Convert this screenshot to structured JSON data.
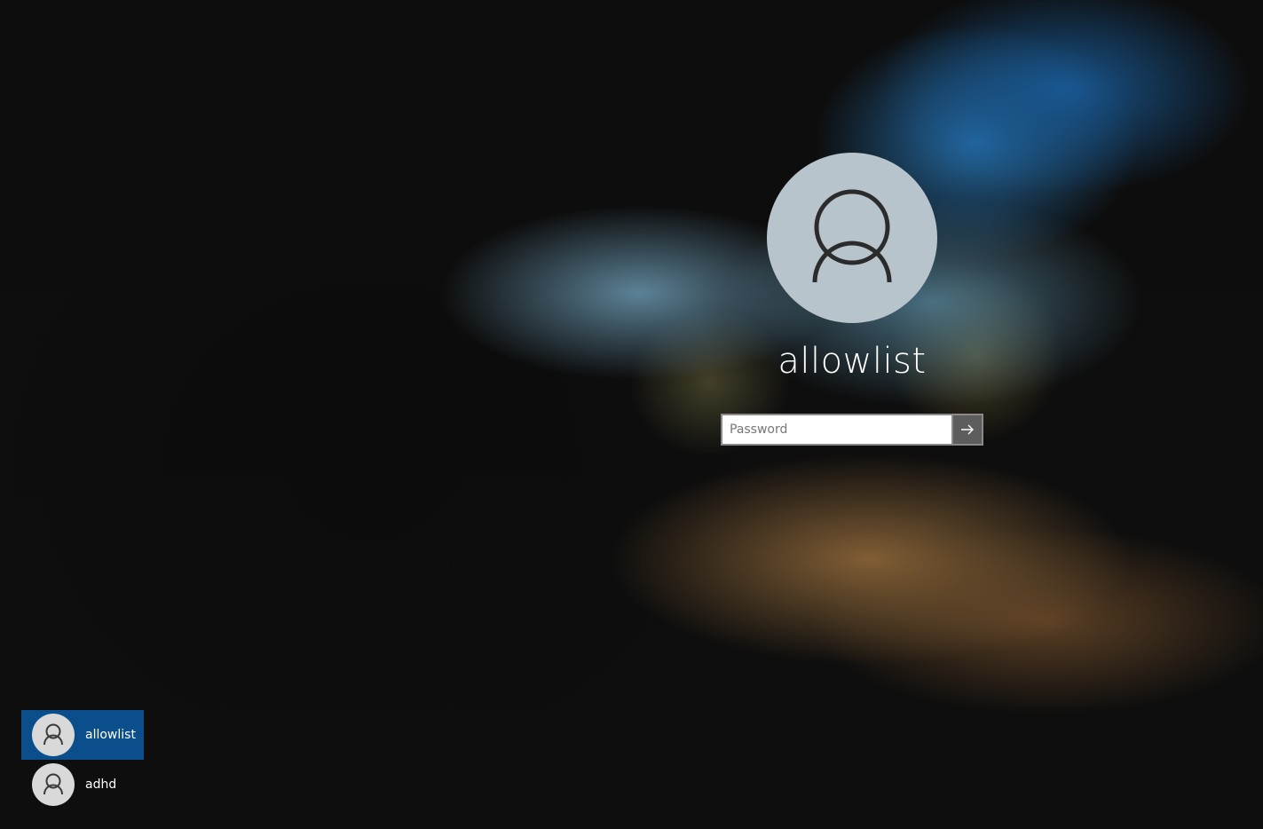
{
  "login": {
    "username": "allowlist",
    "password_placeholder": "Password",
    "password_value": "",
    "submit_icon": "arrow-right-icon",
    "avatar_icon": "user-icon"
  },
  "user_list": [
    {
      "name": "allowlist",
      "selected": true,
      "icon": "user-icon"
    },
    {
      "name": "adhd",
      "selected": false,
      "icon": "user-icon"
    }
  ],
  "colors": {
    "selected_user_bg": "#0a4f8c",
    "avatar_large_bg": "#b8c4cc",
    "avatar_small_bg": "#d9d9d9",
    "submit_button_bg": "#5d5d5d"
  }
}
